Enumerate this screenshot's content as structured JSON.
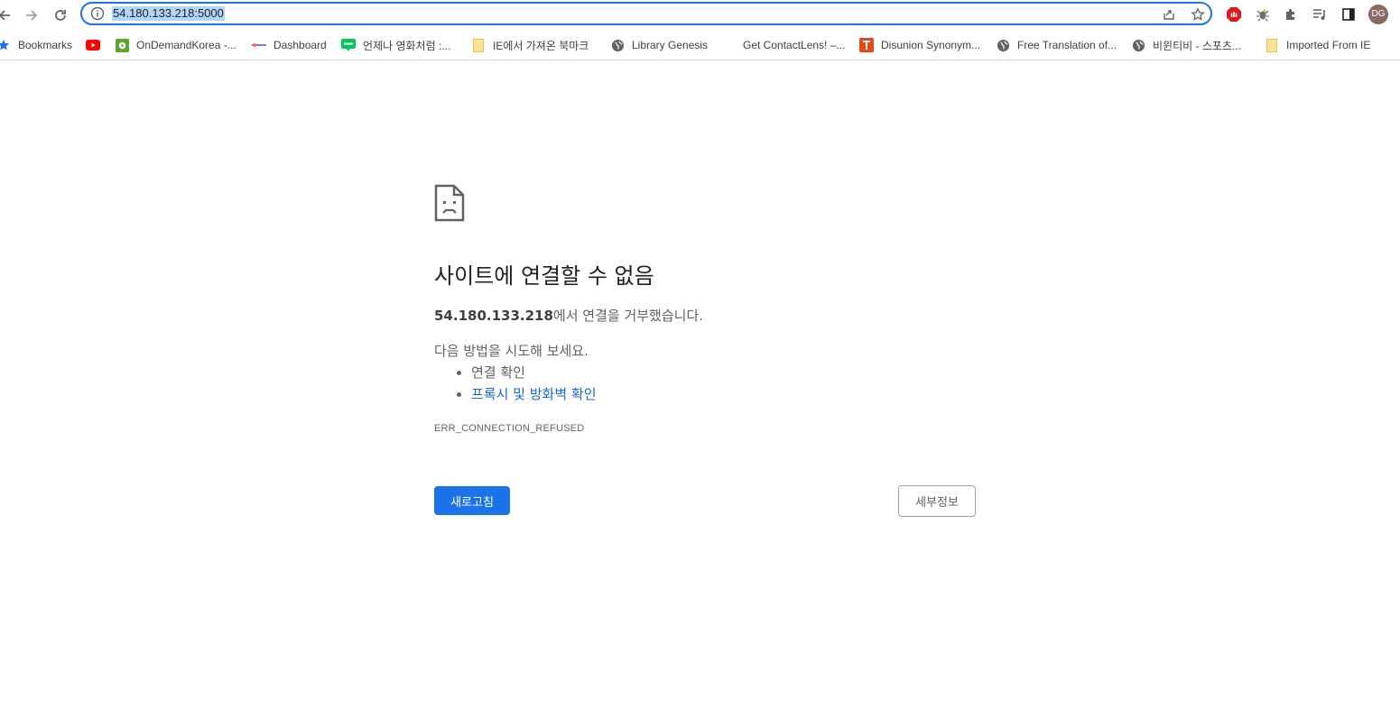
{
  "browser": {
    "url": "54.180.133.218:5000",
    "profile_initials": "DG",
    "accent_color": "#1a73e8"
  },
  "bookmarks": [
    {
      "label": "Bookmarks",
      "icon": "star-icon"
    },
    {
      "label": "",
      "icon": "youtube-icon"
    },
    {
      "label": "OnDemandKorea -...",
      "icon": "ondemandkorea-icon"
    },
    {
      "label": "Dashboard",
      "icon": "dashboard-icon"
    },
    {
      "label": "언제나 영화처럼 :...",
      "icon": "blog-icon"
    },
    {
      "label": "IE에서 가져온 북마크",
      "icon": "folder-icon"
    },
    {
      "label": "Library Genesis",
      "icon": "globe-icon"
    },
    {
      "label": "Get ContactLens! –...",
      "icon": "blank-icon"
    },
    {
      "label": "Disunion Synonym...",
      "icon": "disunion-icon"
    },
    {
      "label": "Free Translation of...",
      "icon": "globe-icon"
    },
    {
      "label": "비윈티비 - 스포츠...",
      "icon": "globe-icon"
    },
    {
      "label": "Imported From IE",
      "icon": "folder-icon"
    }
  ],
  "error": {
    "title": "사이트에 연결할 수 없음",
    "host": "54.180.133.218",
    "host_suffix": "에서 연결을 거부했습니다.",
    "try_heading": "다음 방법을 시도해 보세요.",
    "suggestions": [
      "연결 확인",
      "프록시 및 방화벽 확인"
    ],
    "code": "ERR_CONNECTION_REFUSED",
    "reload_label": "새로고침",
    "details_label": "세부정보"
  }
}
